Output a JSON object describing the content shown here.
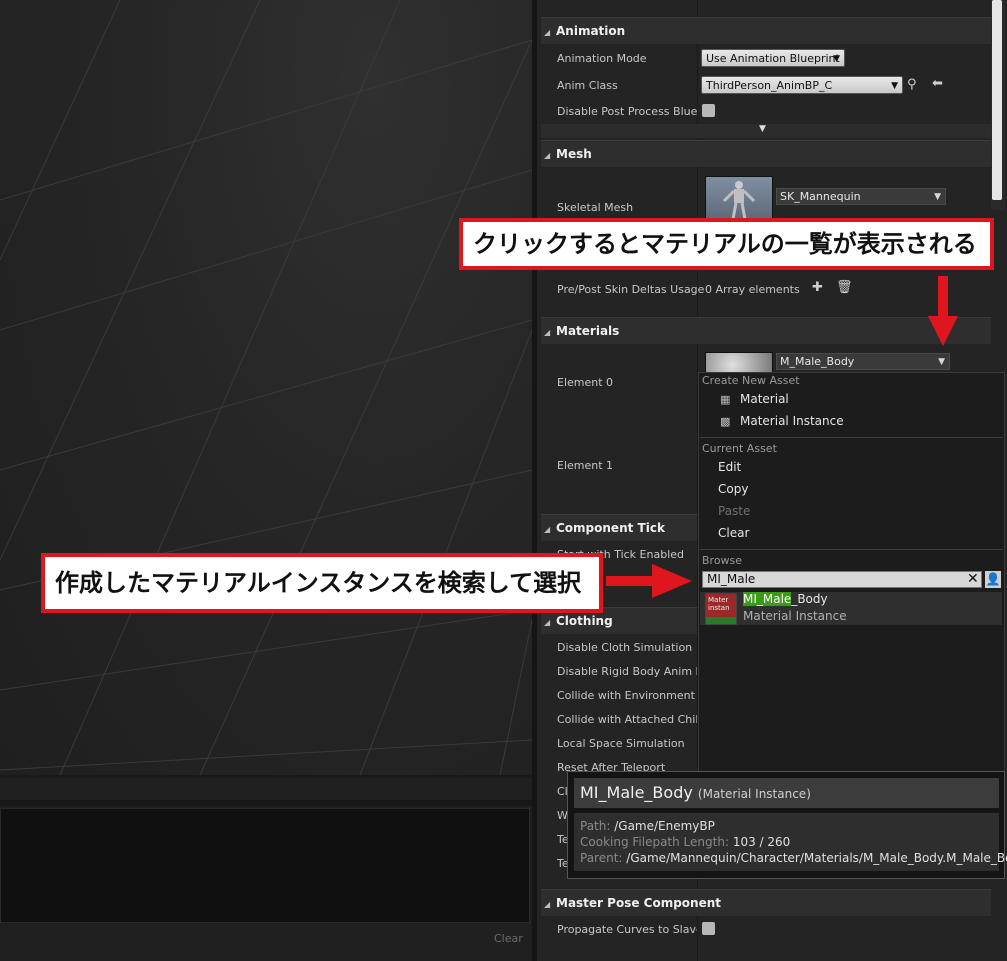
{
  "viewport": {
    "clear_label": "Clear"
  },
  "details": {
    "animation": {
      "header": "Animation",
      "anim_mode_label": "Animation Mode",
      "anim_mode_value": "Use Animation Blueprint",
      "anim_class_label": "Anim Class",
      "anim_class_value": "ThirdPerson_AnimBP_C",
      "disable_pp_label": "Disable Post Process Blueprint"
    },
    "mesh": {
      "header": "Mesh",
      "skeletal_mesh_label": "Skeletal Mesh",
      "skeletal_mesh_value": "SK_Mannequin",
      "skin_deltas_label": "Pre/Post Skin Deltas Usage",
      "skin_deltas_value": "0 Array elements"
    },
    "materials": {
      "header": "Materials",
      "element0_label": "Element 0",
      "element0_value": "M_Male_Body",
      "element1_label": "Element 1"
    },
    "component_tick": {
      "header": "Component Tick",
      "start_tick_label": "Start with Tick Enabled"
    },
    "clothing": {
      "header": "Clothing",
      "rows": [
        "Disable Cloth Simulation",
        "Disable Rigid Body Anim Node",
        "Collide with Environment",
        "Collide with Attached Children",
        "Local Space Simulation",
        "Reset After Teleport",
        "Cl",
        "W",
        "Te",
        "Te"
      ]
    },
    "master_pose": {
      "header": "Master Pose Component",
      "propagate_label": "Propagate Curves to Slaves"
    }
  },
  "menu": {
    "create_header": "Create New Asset",
    "create_items": [
      "Material",
      "Material Instance"
    ],
    "current_header": "Current Asset",
    "current_items": [
      "Edit",
      "Copy",
      "Paste",
      "Clear"
    ],
    "browse_header": "Browse",
    "search_value": "MI_Male",
    "result_match": "MI_Male",
    "result_rest": "_Body",
    "result_type": "Material Instance",
    "result_thumb_text": "Mater instan"
  },
  "tooltip": {
    "name": "MI_Male_Body",
    "kind": "(Material Instance)",
    "path_label": "Path:",
    "path_value": "/Game/EnemyBP",
    "cook_label": "Cooking Filepath Length:",
    "cook_value": "103 / 260",
    "parent_label": "Parent:",
    "parent_value": "/Game/Mannequin/Character/Materials/M_Male_Body.M_Male_Body"
  },
  "annotations": {
    "top": "クリックするとマテリアルの一覧が表示される",
    "left": "作成したマテリアルインスタンスを検索して選択"
  },
  "colors": {
    "accent_red": "#e0161f",
    "highlight_green": "#3b9a18"
  }
}
